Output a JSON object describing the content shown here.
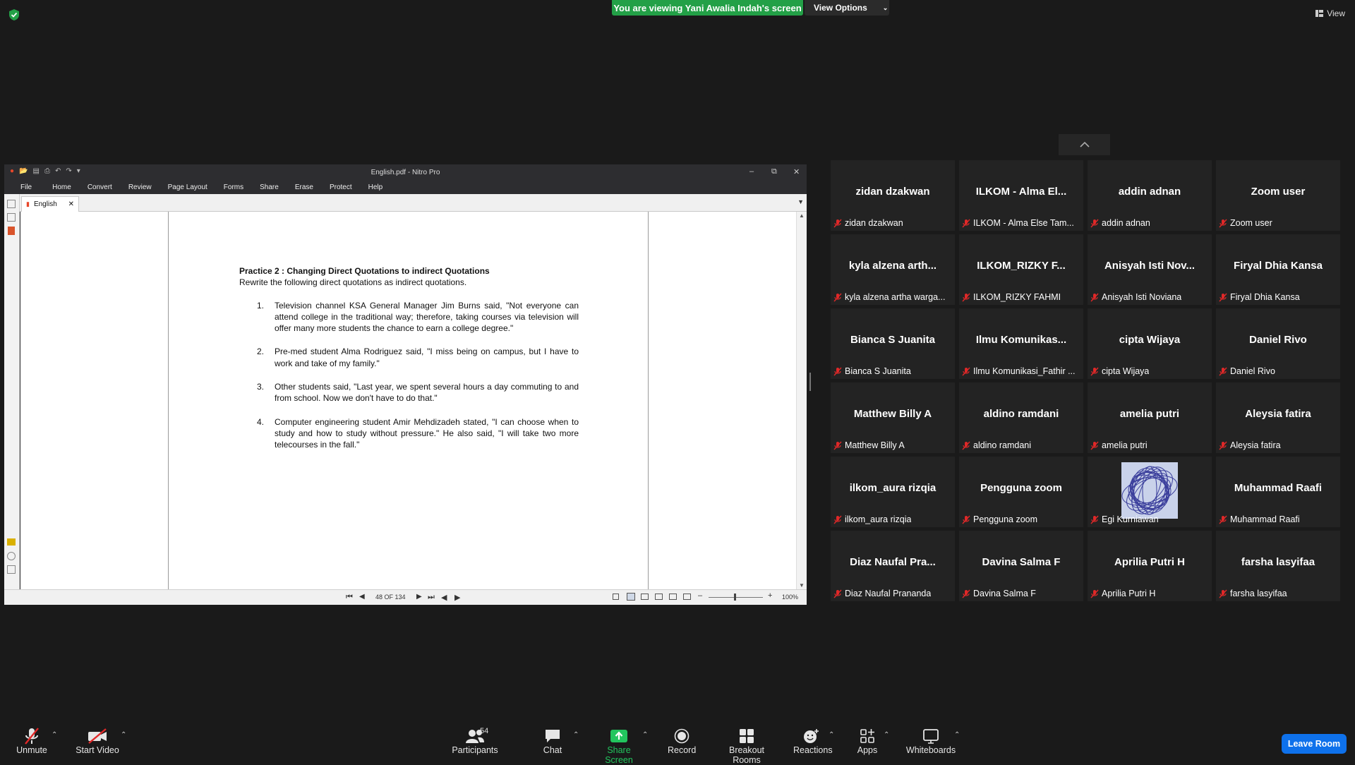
{
  "banner": {
    "viewing_text": "You are viewing Yani Awalia Indah's screen",
    "view_options": "View Options"
  },
  "view_button": "View",
  "nitro": {
    "title": "English.pdf - Nitro Pro",
    "menus": [
      "File",
      "Home",
      "Convert",
      "Review",
      "Page Layout",
      "Forms",
      "Share",
      "Erase",
      "Protect",
      "Help"
    ],
    "tab_label": "English",
    "page_indicator": "48 OF 134",
    "zoom": "100%"
  },
  "document": {
    "title": "Practice 2 : Changing Direct Quotations to indirect Quotations",
    "subtitle": "Rewrite the following direct quotations as indirect quotations.",
    "items": [
      {
        "num": "1.",
        "text": "Television channel KSA General Manager Jim Burns said, \"Not everyone can attend college in  the   traditional way; therefore, taking courses via television will offer many more students the chance to earn a college degree.\""
      },
      {
        "num": "2.",
        "text": "Pre-med student Alma Rodriguez said, \"I miss being on campus, but I have to work and take  of my family.\""
      },
      {
        "num": "3.",
        "text": "Other students said, \"Last year, we spent several hours a day commuting to and from school. Now we don't have to do that.\""
      },
      {
        "num": "4.",
        "text": "Computer engineering student Amir Mehdizadeh stated, \"I can choose when to study and how to study without pressure.\" He also said, \"I will take two more telecourses in the fall.\""
      }
    ]
  },
  "participants": [
    {
      "big": "zidan dzakwan",
      "small": "zidan dzakwan"
    },
    {
      "big": "ILKOM - Alma El...",
      "small": "ILKOM - Alma Else Tam..."
    },
    {
      "big": "addin adnan",
      "small": "addin adnan"
    },
    {
      "big": "Zoom user",
      "small": "Zoom user"
    },
    {
      "big": "kyla alzena arth...",
      "small": "kyla alzena artha warga..."
    },
    {
      "big": "ILKOM_RIZKY F...",
      "small": "ILKOM_RIZKY FAHMI"
    },
    {
      "big": "Anisyah Isti Nov...",
      "small": "Anisyah Isti Noviana"
    },
    {
      "big": "Firyal Dhia Kansa",
      "small": "Firyal Dhia Kansa"
    },
    {
      "big": "Bianca S Juanita",
      "small": "Bianca S Juanita"
    },
    {
      "big": "Ilmu Komunikas...",
      "small": "Ilmu Komunikasi_Fathir ..."
    },
    {
      "big": "cipta Wijaya",
      "small": "cipta Wijaya"
    },
    {
      "big": "Daniel Rivo",
      "small": "Daniel Rivo"
    },
    {
      "big": "Matthew Billy A",
      "small": "Matthew Billy A"
    },
    {
      "big": "aldino ramdani",
      "small": "aldino ramdani"
    },
    {
      "big": "amelia putri",
      "small": "amelia putri"
    },
    {
      "big": "Aleysia fatira",
      "small": "Aleysia fatira"
    },
    {
      "big": "ilkom_aura rizqia",
      "small": "ilkom_aura rizqia"
    },
    {
      "big": "Pengguna zoom",
      "small": "Pengguna zoom"
    },
    {
      "big": "",
      "small": "Egi Kurniawan",
      "has_avatar": true
    },
    {
      "big": "Muhammad Raafi",
      "small": "Muhammad Raafi"
    },
    {
      "big": "Diaz Naufal Pra...",
      "small": "Diaz Naufal Prananda"
    },
    {
      "big": "Davina Salma F",
      "small": "Davina Salma F"
    },
    {
      "big": "Aprilia Putri H",
      "small": "Aprilia Putri H"
    },
    {
      "big": "farsha lasyifaa",
      "small": "farsha lasyifaa"
    }
  ],
  "toolbar": {
    "unmute": "Unmute",
    "start_video": "Start Video",
    "participants": "Participants",
    "participants_count": "54",
    "chat": "Chat",
    "share_screen": "Share Screen",
    "record": "Record",
    "breakout_rooms": "Breakout Rooms",
    "reactions": "Reactions",
    "apps": "Apps",
    "whiteboards": "Whiteboards",
    "leave_room": "Leave Room"
  },
  "colors": {
    "banner_green": "#23a047",
    "share_green": "#22c55e",
    "leave_blue": "#0e71eb",
    "mic_red": "#e02828"
  }
}
